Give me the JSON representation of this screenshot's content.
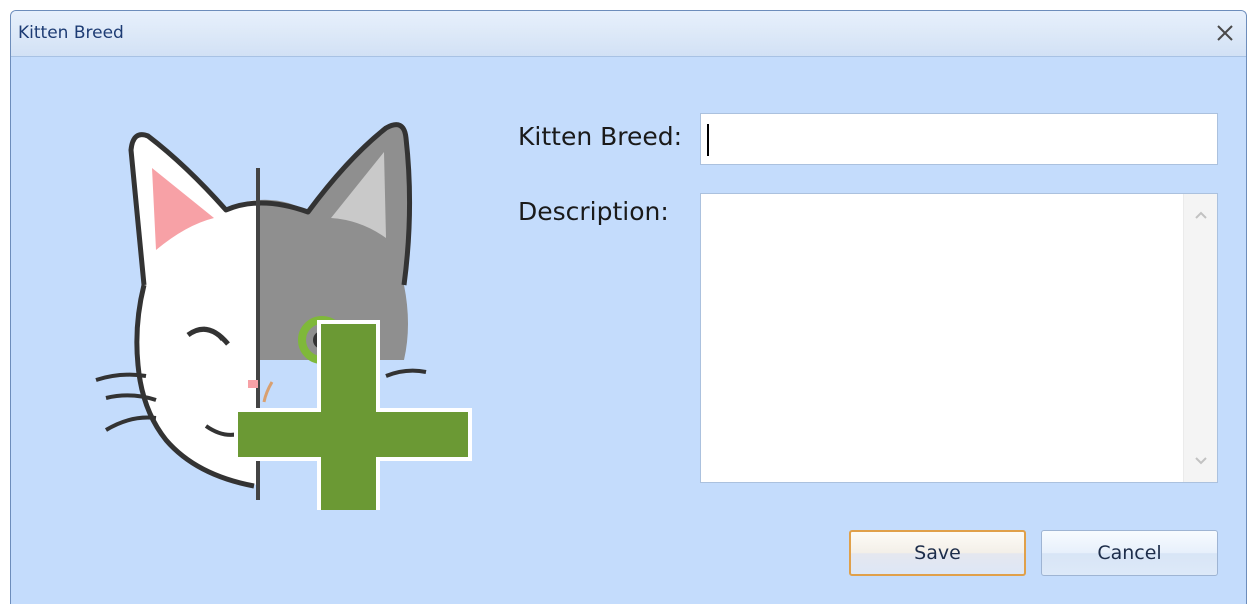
{
  "window": {
    "title": "Kitten Breed"
  },
  "form": {
    "breed_label": "Kitten Breed:",
    "breed_value": "",
    "description_label": "Description:",
    "description_value": ""
  },
  "buttons": {
    "save_label": "Save",
    "cancel_label": "Cancel"
  },
  "icons": {
    "close": "close-icon",
    "graphic": "kitten-add-icon",
    "scroll_up": "chevron-up-icon",
    "scroll_down": "chevron-down-icon"
  },
  "colors": {
    "background": "#c4dcfc",
    "plus_green": "#6b9934",
    "ear_pink": "#f7a1a6",
    "cat_gray": "#8f8f8f",
    "eye_green": "#7fb83a",
    "save_border": "#e0a04a"
  }
}
